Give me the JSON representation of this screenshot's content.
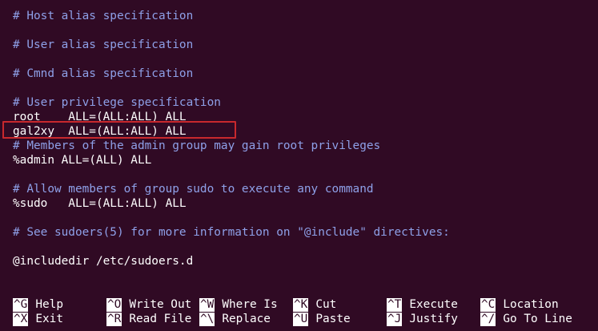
{
  "file_lines": [
    "# Host alias specification",
    "# User alias specification",
    "# Cmnd alias specification",
    "# User privilege specification",
    "root    ALL=(ALL:ALL) ALL",
    "gal2xy  ALL=(ALL:ALL) ALL",
    "# Members of the admin group may gain root privileges",
    "%admin ALL=(ALL) ALL",
    "# Allow members of group sudo to execute any command",
    "%sudo   ALL=(ALL:ALL) ALL",
    "# See sudoers(5) for more information on \"@include\" directives:",
    "@includedir /etc/sudoers.d"
  ],
  "shortcuts": [
    {
      "key": "^G",
      "action": "Help"
    },
    {
      "key": "^O",
      "action": "Write Out"
    },
    {
      "key": "^W",
      "action": "Where Is"
    },
    {
      "key": "^K",
      "action": "Cut"
    },
    {
      "key": "^T",
      "action": "Execute"
    },
    {
      "key": "^C",
      "action": "Location"
    },
    {
      "key": "^X",
      "action": "Exit"
    },
    {
      "key": "^R",
      "action": "Read File"
    },
    {
      "key": "^\\",
      "action": "Replace"
    },
    {
      "key": "^U",
      "action": "Paste"
    },
    {
      "key": "^J",
      "action": "Justify"
    },
    {
      "key": "^/",
      "action": "Go To Line"
    }
  ],
  "colors": {
    "background": "#300a24",
    "comment": "#8ea0e8",
    "text": "#ffffff",
    "highlight_border": "#c8282d"
  }
}
